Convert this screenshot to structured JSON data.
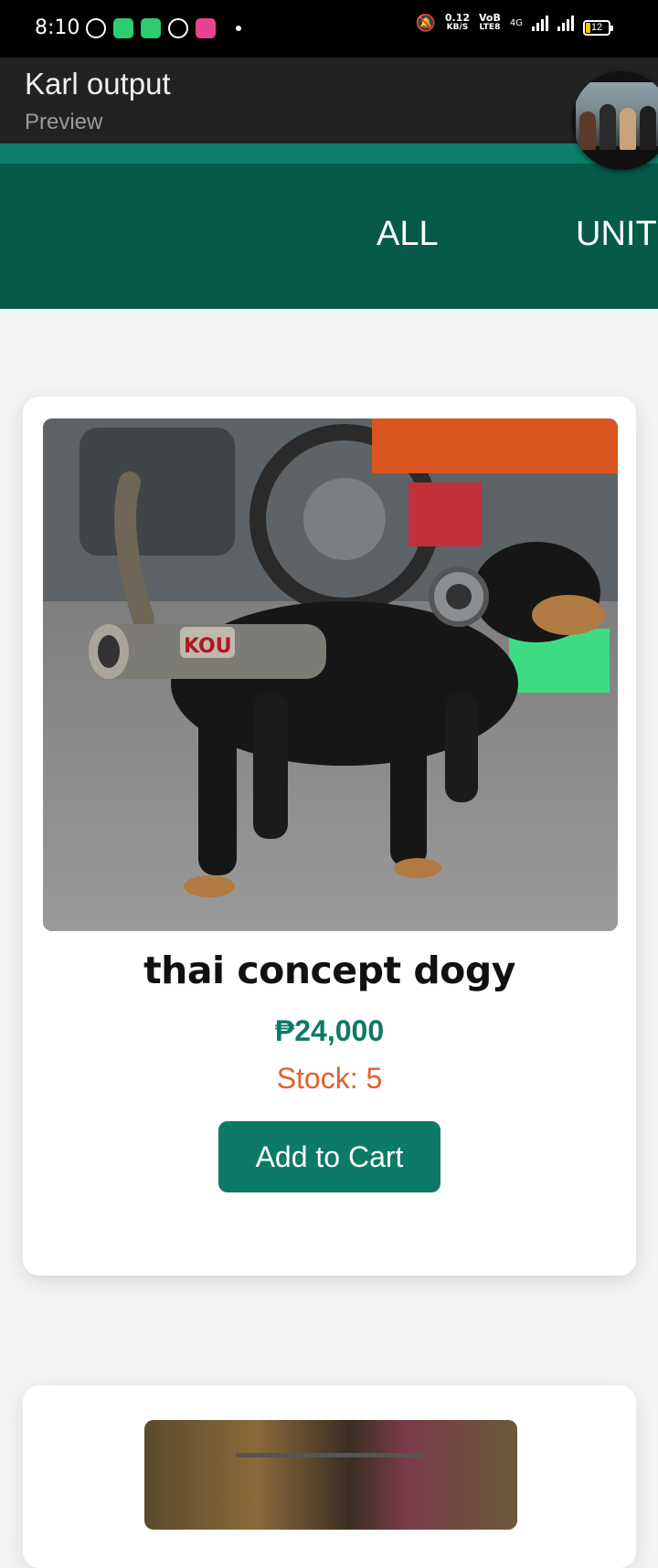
{
  "status_bar": {
    "time": "8:10",
    "net_speed_value": "0.12",
    "net_speed_unit": "KB/S",
    "volte_top": "VoB",
    "volte_bottom": "LTE8",
    "network": "4G",
    "battery": "12"
  },
  "header": {
    "title": "Karl output",
    "subtitle": "Preview"
  },
  "tabs": [
    {
      "label": "ALL"
    },
    {
      "label": "UNIT"
    }
  ],
  "product": {
    "name": "thai concept dogy",
    "price": "₱24,000",
    "stock": "Stock: 5",
    "button_label": "Add to Cart",
    "image_badge": "KOU"
  },
  "colors": {
    "accent": "#0b7a66",
    "tabs_bg": "#055a4a",
    "stock": "#e2602d"
  }
}
